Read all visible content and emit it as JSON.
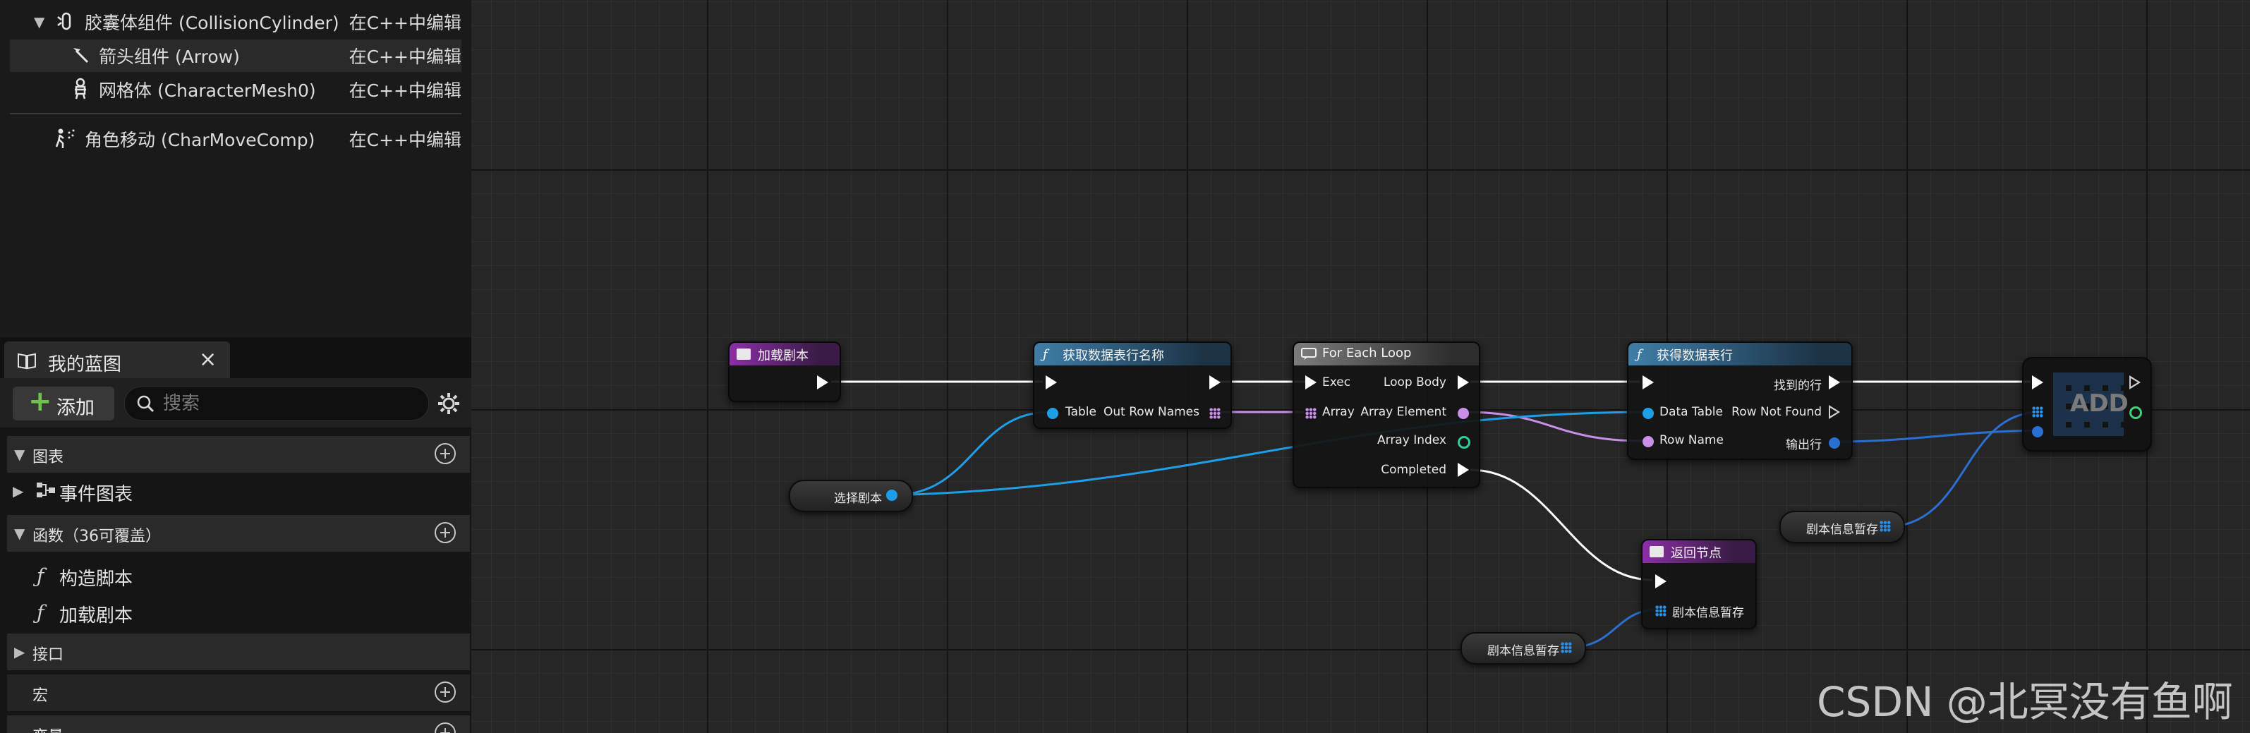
{
  "components": [
    {
      "name": "胶囊体组件 (CollisionCylinder)",
      "edit": "在C++中编辑",
      "icon": "capsule-component-icon",
      "expanded": true
    },
    {
      "name": "箭头组件 (Arrow)",
      "edit": "在C++中编辑",
      "icon": "arrow-component-icon",
      "selected": true
    },
    {
      "name": "网格体 (CharacterMesh0)",
      "edit": "在C++中编辑",
      "icon": "skeletal-mesh-icon"
    },
    {
      "name": "角色移动 (CharMoveComp)",
      "edit": "在C++中编辑",
      "icon": "character-movement-icon"
    }
  ],
  "my_blueprint": {
    "tab_label": "我的蓝图",
    "close": "×",
    "add_label": "添加",
    "search_placeholder": "搜索",
    "sections": {
      "graphs": "图表",
      "functions": "函数（36可覆盖）",
      "interfaces": "接口",
      "macros": "宏",
      "variables": "变量"
    },
    "graph_items": [
      "事件图表"
    ],
    "function_items": [
      "构造脚本",
      "加载剧本"
    ]
  },
  "graph": {
    "nodes": {
      "load_script": {
        "title": "加载剧本"
      },
      "get_row_names": {
        "title": "获取数据表行名称",
        "pin_table": "Table",
        "pin_out_row_names": "Out Row Names"
      },
      "for_each": {
        "title": "For Each Loop",
        "pin_exec": "Exec",
        "pin_loop_body": "Loop Body",
        "pin_array": "Array",
        "pin_array_element": "Array Element",
        "pin_array_index": "Array Index",
        "pin_completed": "Completed"
      },
      "get_row": {
        "title": "获得数据表行",
        "pin_data_table": "Data Table",
        "pin_row_name": "Row Name",
        "pin_found": "找到的行",
        "pin_not_found": "Row Not Found",
        "pin_out_row": "输出行"
      },
      "return": {
        "title": "返回节点",
        "pin_value": "剧本信息暂存"
      },
      "add": {
        "label": "ADD"
      }
    },
    "variables": {
      "select_script": "选择剧本",
      "script_info_1": "剧本信息暂存",
      "script_info_2": "剧本信息暂存"
    }
  },
  "watermark": "CSDN @北冥没有鱼啊",
  "colors": {
    "accent_event": "#8b2fa6",
    "accent_func": "#3f7ea8",
    "pin_blue": "#1f9ee8",
    "pin_pink": "#c98ee8",
    "add_green": "#6fc24a"
  }
}
